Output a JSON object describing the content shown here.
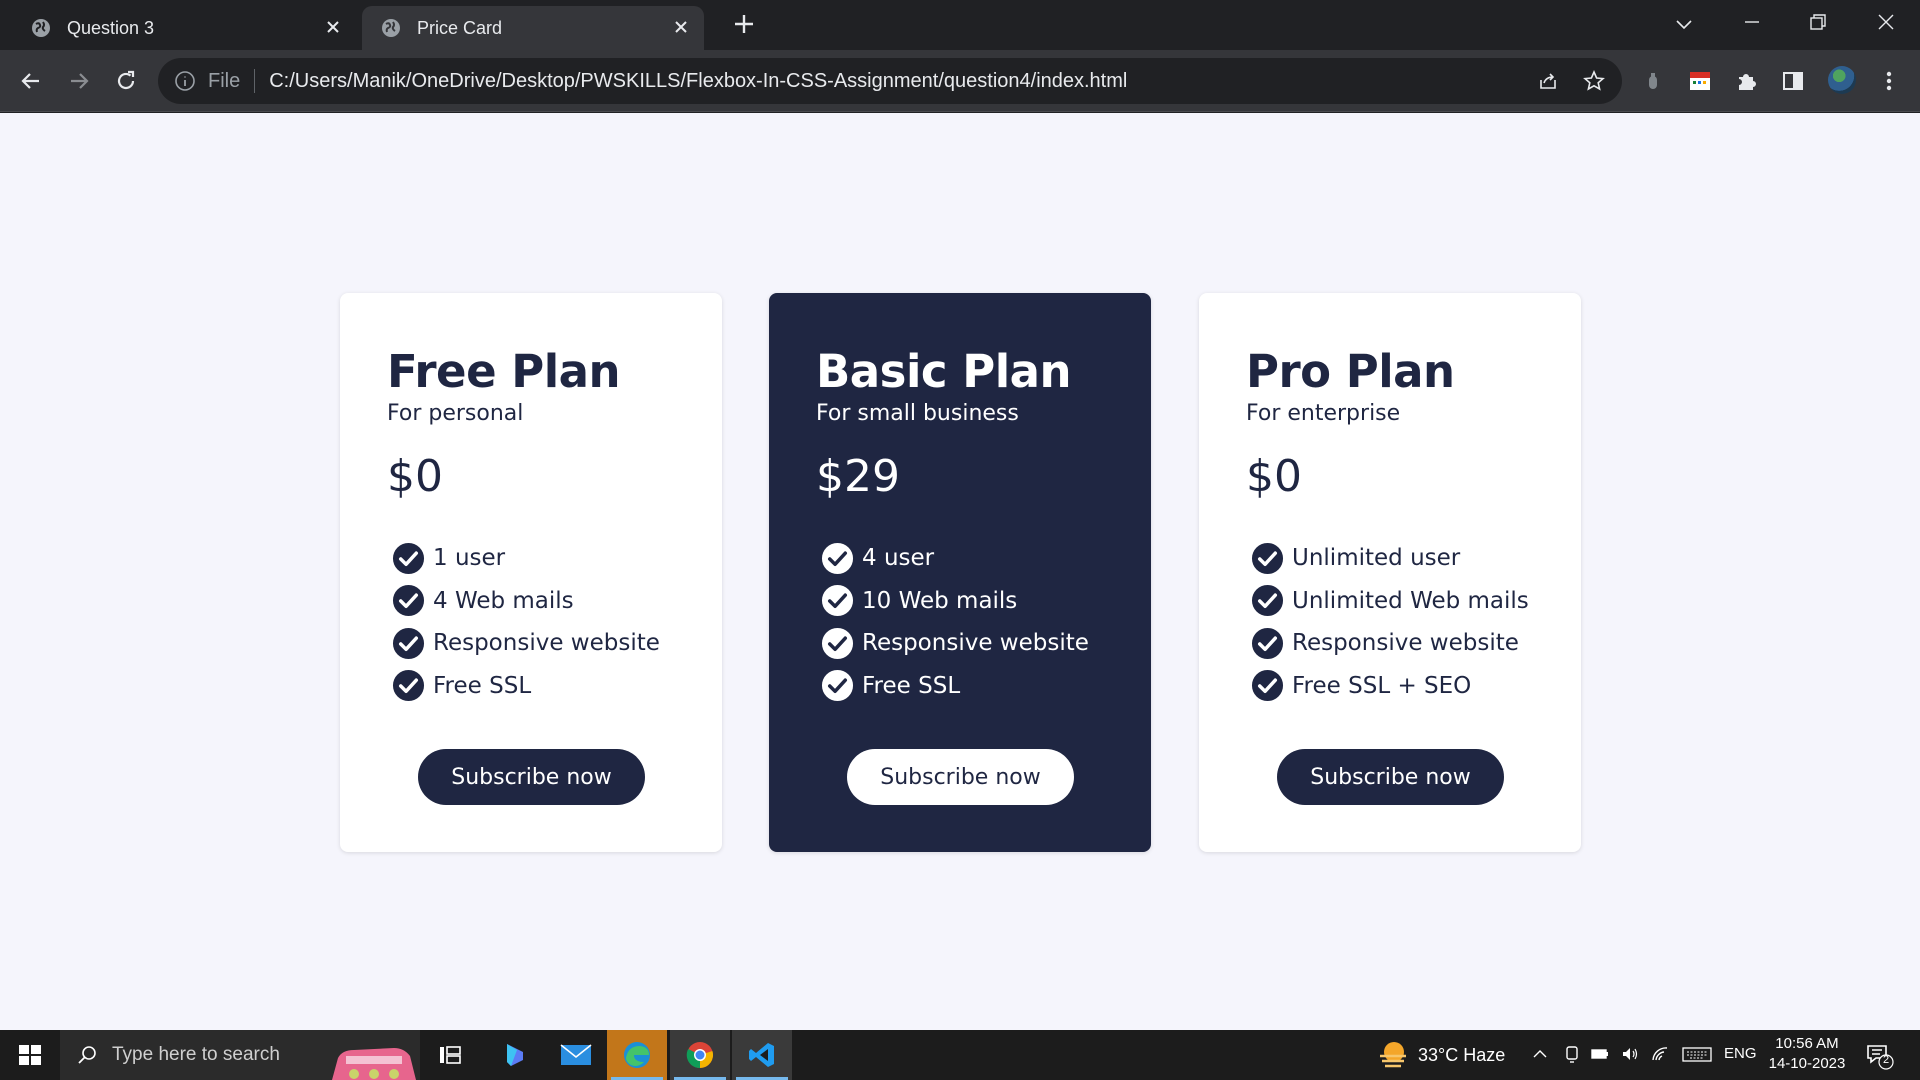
{
  "browser": {
    "tabs": [
      {
        "title": "Question 3",
        "active": false
      },
      {
        "title": "Price Card",
        "active": true
      }
    ],
    "address_bar": {
      "scheme_label": "File",
      "url": "C:/Users/Manik/OneDrive/Desktop/PWSKILLS/Flexbox-In-CSS-Assignment/question4/index.html"
    }
  },
  "page": {
    "plans": [
      {
        "name": "Free Plan",
        "subtitle": "For personal",
        "price": "$0",
        "features": [
          "1 user",
          "4 Web mails",
          "Responsive website",
          "Free SSL"
        ],
        "button": "Subscribe now",
        "theme": "light"
      },
      {
        "name": "Basic Plan",
        "subtitle": "For small business",
        "price": "$29",
        "features": [
          "4 user",
          "10 Web mails",
          "Responsive website",
          "Free SSL"
        ],
        "button": "Subscribe now",
        "theme": "dark"
      },
      {
        "name": "Pro Plan",
        "subtitle": "For enterprise",
        "price": "$0",
        "features": [
          "Unlimited user",
          "Unlimited Web mails",
          "Responsive website",
          "Free SSL + SEO"
        ],
        "button": "Subscribe now",
        "theme": "light"
      }
    ],
    "colors": {
      "navy": "#1f2642",
      "page_bg": "#f5f5fc",
      "card_bg": "#ffffff"
    }
  },
  "taskbar": {
    "search_placeholder": "Type here to search",
    "weather": "33°C  Haze",
    "language": "ENG",
    "time": "10:56 AM",
    "date": "14-10-2023",
    "notification_count": "2",
    "apps": [
      "task-view-icon",
      "copilot-icon",
      "mail-icon",
      "edge-icon",
      "chrome-icon",
      "vscode-icon"
    ]
  }
}
